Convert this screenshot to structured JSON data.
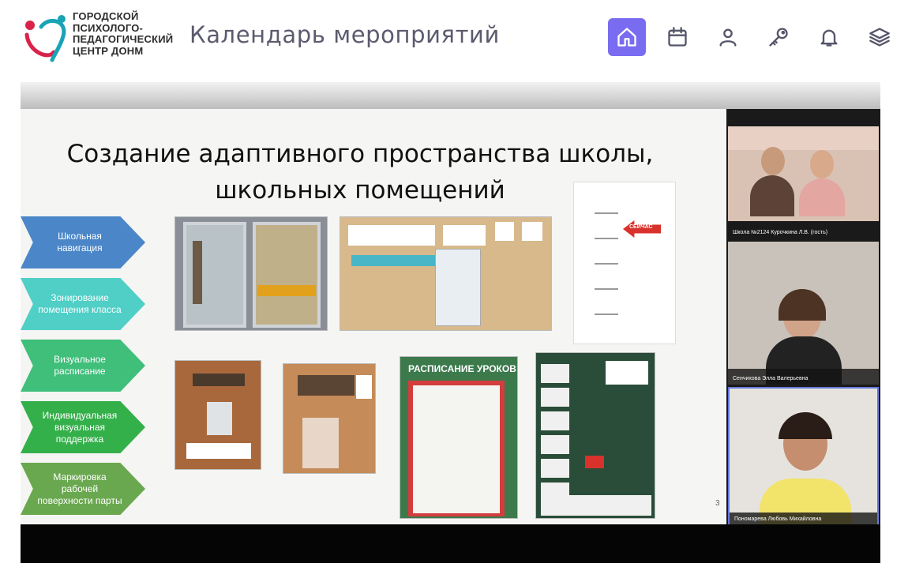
{
  "logo": {
    "lines": [
      "ГОРОДСКОЙ",
      "ПСИХОЛОГО-",
      "ПЕДАГОГИЧЕСКИЙ",
      "ЦЕНТР ДОНМ"
    ]
  },
  "header": {
    "title": "Календарь мероприятий",
    "nav": [
      {
        "icon": "home-icon",
        "active": true
      },
      {
        "icon": "calendar-icon",
        "active": false
      },
      {
        "icon": "user-icon",
        "active": false
      },
      {
        "icon": "key-icon",
        "active": false
      },
      {
        "icon": "bell-icon",
        "active": false
      },
      {
        "icon": "layers-icon",
        "active": false
      }
    ],
    "accent_color": "#7a6cf0"
  },
  "slide": {
    "title_line1": "Создание адаптивного пространства школы,",
    "title_line2": "школьных помещений",
    "page_number": "3",
    "steps": [
      {
        "label": "Школьная навигация",
        "color": "#4a86c8"
      },
      {
        "label": "Зонирование помещения класса",
        "color": "#4fcfc6"
      },
      {
        "label": "Визуальное расписание",
        "color": "#3fbf7a"
      },
      {
        "label": "Индивидуальная визуальная поддержка",
        "color": "#34b04a"
      },
      {
        "label": "Маркировка рабочей поверхности парты",
        "color": "#6aa84f"
      }
    ],
    "badge_now": "СЕЙЧАС",
    "schedule_title": "РАСПИСАНИЕ УРОКОВ"
  },
  "participants": [
    {
      "name": "Школа №2124 Курочкина Л.В. (гость)"
    },
    {
      "name": "Сенчихова Элла Валерьевна"
    },
    {
      "name": "Пономарева Любовь Михайловна"
    }
  ]
}
